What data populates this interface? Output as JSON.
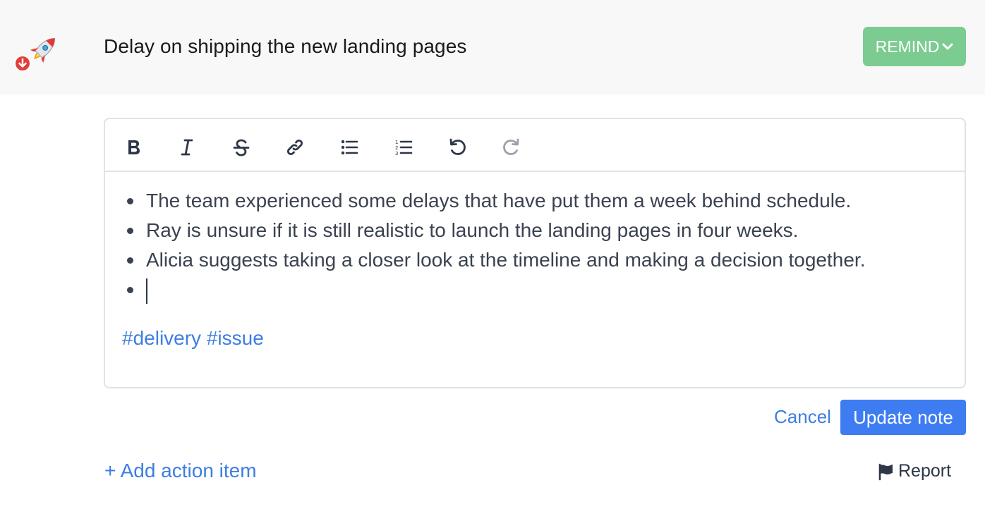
{
  "topic": {
    "title": "Delay on shipping the new landing pages",
    "icon": "rocket-icon",
    "badge_icon": "down-arrow-badge-icon"
  },
  "remind_button": {
    "label": "REMIND"
  },
  "toolbar": {
    "buttons": [
      "bold-icon",
      "italic-icon",
      "strikethrough-icon",
      "link-icon",
      "bullet-list-icon",
      "numbered-list-icon",
      "undo-icon",
      "redo-icon"
    ]
  },
  "note": {
    "bullets": [
      "The team experienced some delays that have put them a week behind schedule.",
      "Ray is unsure if it is still realistic to launch the landing pages in four weeks.",
      "Alicia suggests taking a closer look at the timeline and making a decision together.",
      ""
    ],
    "tags": [
      "#delivery",
      "#issue"
    ]
  },
  "actions": {
    "cancel_label": "Cancel",
    "update_label": "Update note",
    "add_action_label": "+ Add action item",
    "report_label": "Report"
  },
  "colors": {
    "accent_blue": "#3e7cf2",
    "remind_green": "#7ccb91",
    "header_bg": "#f8f8f8"
  }
}
